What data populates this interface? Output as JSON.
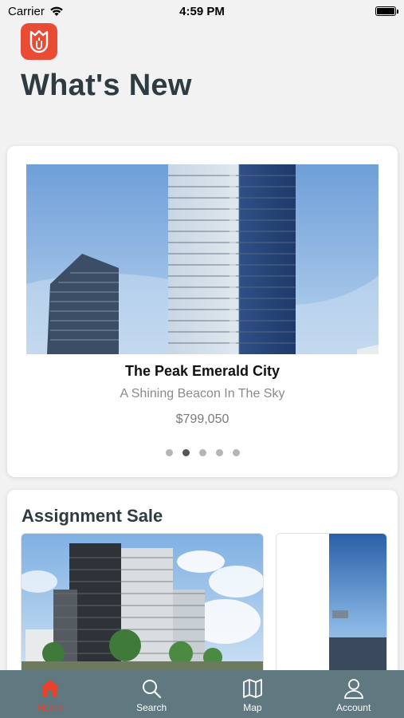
{
  "status_bar": {
    "carrier": "Carrier",
    "time": "4:59 PM"
  },
  "header": {
    "title": "What's New",
    "logo_icon": "shield-leaf-logo",
    "logo_color": "#ea4b35"
  },
  "featured": {
    "title": "The Peak Emerald City",
    "subtitle": "A Shining Beacon In The Sky",
    "price": "$799,050",
    "carousel_pages": 5,
    "active_page_index": 1
  },
  "assignment_sale": {
    "title": "Assignment Sale",
    "listings": [
      {
        "image": "condo-building-photo"
      },
      {
        "image": "skyline-photo"
      }
    ]
  },
  "tabbar": {
    "background": "#607880",
    "active_color": "#e8412c",
    "tabs": [
      {
        "label": "Home",
        "icon": "home-icon",
        "active": true
      },
      {
        "label": "Search",
        "icon": "search-icon",
        "active": false
      },
      {
        "label": "Map",
        "icon": "map-icon",
        "active": false
      },
      {
        "label": "Account",
        "icon": "account-icon",
        "active": false
      }
    ]
  }
}
